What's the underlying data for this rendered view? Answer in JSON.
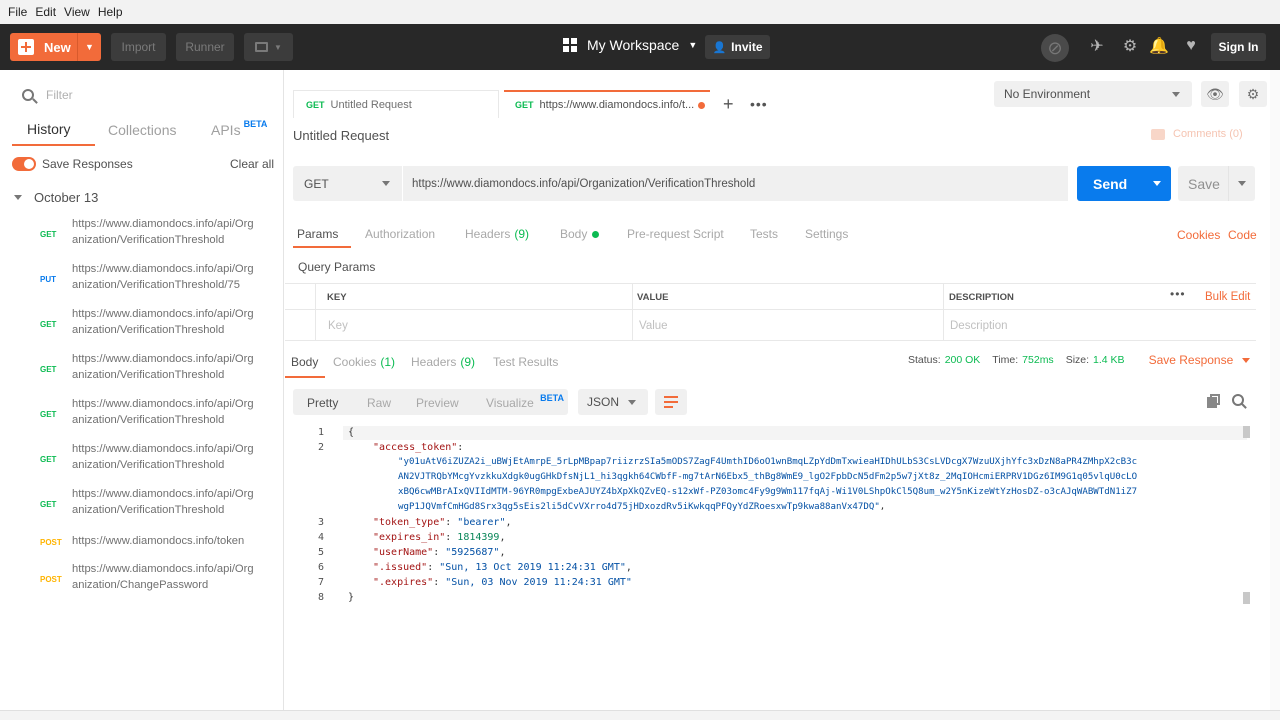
{
  "menu": [
    "File",
    "Edit",
    "View",
    "Help"
  ],
  "header": {
    "new_label": "New",
    "import_label": "Import",
    "runner_label": "Runner",
    "workspace_label": "My Workspace",
    "invite_label": "Invite",
    "signin_label": "Sign In"
  },
  "sidebar": {
    "filter_placeholder": "Filter",
    "tabs": {
      "history": "History",
      "collections": "Collections",
      "apis": "APIs",
      "apis_badge": "BETA"
    },
    "save_responses_label": "Save Responses",
    "clear_all_label": "Clear all",
    "day_label": "October 13",
    "history": [
      {
        "method": "GET",
        "url_line1": "https://www.diamondocs.info/api/Org",
        "url_line2": "anization/VerificationThreshold"
      },
      {
        "method": "PUT",
        "url_line1": "https://www.diamondocs.info/api/Org",
        "url_line2": "anization/VerificationThreshold/75"
      },
      {
        "method": "GET",
        "url_line1": "https://www.diamondocs.info/api/Org",
        "url_line2": "anization/VerificationThreshold"
      },
      {
        "method": "GET",
        "url_line1": "https://www.diamondocs.info/api/Org",
        "url_line2": "anization/VerificationThreshold"
      },
      {
        "method": "GET",
        "url_line1": "https://www.diamondocs.info/api/Org",
        "url_line2": "anization/VerificationThreshold"
      },
      {
        "method": "GET",
        "url_line1": "https://www.diamondocs.info/api/Org",
        "url_line2": "anization/VerificationThreshold"
      },
      {
        "method": "GET",
        "url_line1": "https://www.diamondocs.info/api/Org",
        "url_line2": "anization/VerificationThreshold"
      },
      {
        "method": "POST",
        "url_line1": "https://www.diamondocs.info/token",
        "url_line2": ""
      },
      {
        "method": "POST",
        "url_line1": "https://www.diamondocs.info/api/Org",
        "url_line2": "anization/ChangePassword"
      }
    ]
  },
  "tabs": [
    {
      "method": "GET",
      "title": "Untitled Request"
    },
    {
      "method": "GET",
      "title": "https://www.diamondocs.info/t..."
    }
  ],
  "environment": {
    "selected": "No Environment"
  },
  "request": {
    "title": "Untitled Request",
    "comments_label": "Comments (0)",
    "method": "GET",
    "url": "https://www.diamondocs.info/api/Organization/VerificationThreshold",
    "send_label": "Send",
    "save_label": "Save"
  },
  "request_tabs": {
    "params": "Params",
    "authorization": "Authorization",
    "headers": "Headers",
    "headers_count": "(9)",
    "body": "Body",
    "prerequest": "Pre-request Script",
    "tests": "Tests",
    "settings": "Settings",
    "cookies": "Cookies",
    "code": "Code"
  },
  "query_params": {
    "title": "Query Params",
    "col_key": "KEY",
    "col_value": "VALUE",
    "col_description": "DESCRIPTION",
    "bulk_edit": "Bulk Edit",
    "key_placeholder": "Key",
    "value_placeholder": "Value",
    "description_placeholder": "Description"
  },
  "response": {
    "tabs": {
      "body": "Body",
      "cookies": "Cookies",
      "cookies_count": "(1)",
      "headers": "Headers",
      "headers_count": "(9)",
      "test_results": "Test Results"
    },
    "status_label": "Status:",
    "status_value": "200 OK",
    "time_label": "Time:",
    "time_value": "752ms",
    "size_label": "Size:",
    "size_value": "1.4 KB",
    "save_response_label": "Save Response",
    "views": {
      "pretty": "Pretty",
      "raw": "Raw",
      "preview": "Preview",
      "visualize": "Visualize",
      "visualize_badge": "BETA"
    },
    "format": "JSON",
    "line_numbers": [
      "1",
      "2",
      "3",
      "4",
      "5",
      "6",
      "7",
      "8"
    ],
    "body_lines": {
      "open_brace": "{",
      "access_token_key": "\"access_token\"",
      "access_token_val1": "\"y01uAtV6iZUZA2i_uBWjEtAmrpE_5rLpMBpap7riizrzSIa5mODS7ZagF4UmthID6oO1wnBmqLZpYdDmTxwieaHIDhULbS3CsLVDcgX7WzuUXjhYfc3xDzN8aPR4ZMhpX2cB3c",
      "access_token_val2": "AN2VJTRQbYMcgYvzkkuXdgk0ugGHkDfsNjL1_hi3qgkh64CWbfF-mg7tArN6Ebx5_thBg8WmE9_lgO2FpbDcN5dFm2p5w7jXt8z_2MqIOHcmiERPRV1DGz6IM9G1q05vlqU0cLO",
      "access_token_val3": "xBQ6cwMBrAIxQVIIdMTM-96YR0mpgExbeAJUYZ4bXpXkQZvEQ-s12xWf-PZ03omc4Fy9g9Wm117fqAj-Wi1V0LShpOkCl5Q8um_w2Y5nKizeWtYzHosDZ-o3cAJqWABWTdN1iZ7",
      "access_token_val4": "wgP1JQVmfCmHGd8Srx3qg5sEis2li5dCvVXrro4d75jHDxozdRv5iKwkqqPFQyYdZRoesxwTp9kwa88anVx47DQ\"",
      "token_type_key": "\"token_type\"",
      "token_type_val": "\"bearer\"",
      "expires_in_key": "\"expires_in\"",
      "expires_in_val": "1814399",
      "username_key": "\"userName\"",
      "username_val": "\"5925687\"",
      "issued_key": "\".issued\"",
      "issued_val": "\"Sun, 13 Oct 2019 11:24:31 GMT\"",
      "expires_key": "\".expires\"",
      "expires_val": "\"Sun, 03 Nov 2019 11:24:31 GMT\"",
      "close_brace": "}"
    }
  },
  "colors": {
    "accent": "#f26b3a",
    "send": "#097bed",
    "get": "#0cbb52",
    "put": "#097bed",
    "post": "#ffb400",
    "header_bg": "#282828"
  }
}
